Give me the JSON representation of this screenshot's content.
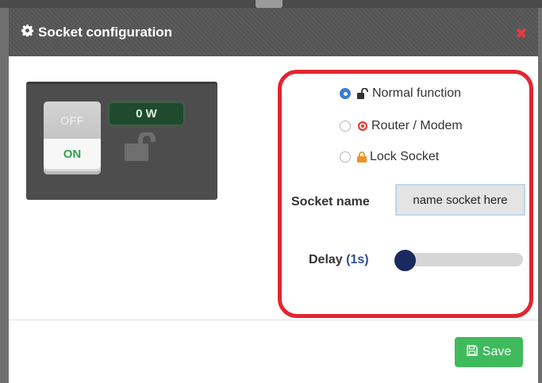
{
  "modal": {
    "title": "Socket configuration",
    "title_icon": "gear-icon",
    "close_icon": "close-icon"
  },
  "device": {
    "switch_off_label": "OFF",
    "switch_on_label": "ON",
    "power_reading": "0 W",
    "lock_state_icon": "unlock-icon"
  },
  "modes": [
    {
      "label": "Normal function",
      "icon": "unlock-icon",
      "selected": true
    },
    {
      "label": "Router / Modem",
      "icon": "router-icon",
      "selected": false
    },
    {
      "label": "Lock Socket",
      "icon": "lock-icon",
      "selected": false
    }
  ],
  "socket_name": {
    "label": "Socket name",
    "value": "name socket here"
  },
  "delay": {
    "label": "Delay",
    "value": "(1s)",
    "level": 0
  },
  "footer": {
    "save_label": "Save",
    "save_icon": "floppy-disk-icon"
  },
  "colors": {
    "header_bg": "#575757",
    "highlight_border": "#e32530",
    "radio_selected": "#3a7bd5",
    "save_button": "#3fba5c",
    "switch_on_text": "#2fa24a",
    "slider_thumb": "#1b2a5e",
    "delay_value": "#2a4f8c"
  }
}
